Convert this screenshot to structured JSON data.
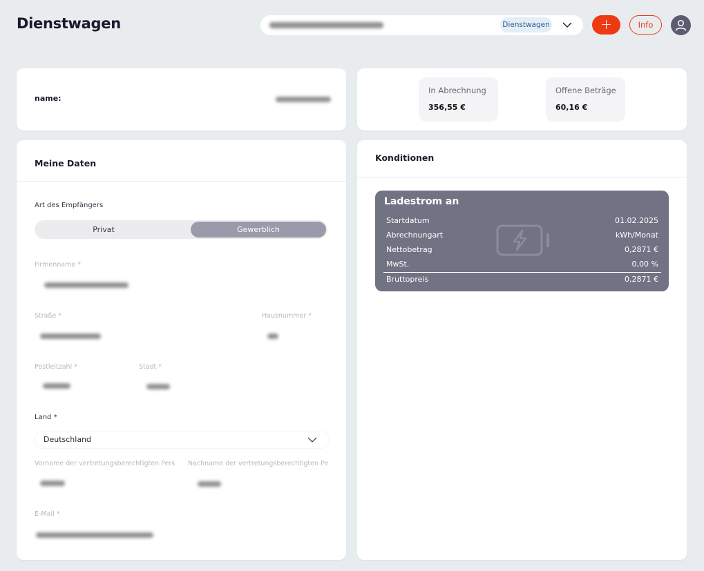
{
  "header": {
    "title": "Dienstwagen",
    "selector_badge": "Dienstwagen",
    "add_label": "+",
    "info_label": "Info"
  },
  "name_card": {
    "label": "name:"
  },
  "stats": [
    {
      "label": "In Abrechnung",
      "value": "356,55 €"
    },
    {
      "label": "Offene Beträge",
      "value": "60,16 €"
    }
  ],
  "meine_daten": {
    "title": "Meine Daten",
    "recipient_type_label": "Art des Empfängers",
    "toggle": {
      "option_1": "Privat",
      "option_2": "Gewerblich",
      "selected": "Gewerblich"
    },
    "fields": {
      "firmenname": "Firmenname *",
      "strasse": "Straße *",
      "hausnummer": "Hausnummer *",
      "plz": "Postleitzahl *",
      "stadt": "Stadt *",
      "land": "Land *",
      "vorname": "Vorname der vertretungsberechtigten Pers",
      "nachname": "Nachname der vertretungsberechtigten Pe",
      "email": "E-Mail *"
    },
    "land_value": "Deutschland"
  },
  "konditionen": {
    "title": "Konditionen",
    "tariff_title": "Ladestrom an",
    "rows": [
      {
        "key": "Startdatum",
        "value": "01.02.2025"
      },
      {
        "key": "Abrechnungart",
        "value": "kWh/Monat"
      },
      {
        "key": "Nettobetrag",
        "value": "0,2871 €"
      },
      {
        "key": "MwSt.",
        "value": "0,00 %"
      },
      {
        "key": "Bruttopreis",
        "value": "0,2871 €"
      }
    ]
  },
  "colors": {
    "accent": "#ee3a12",
    "tariff_bg": "#727285",
    "toggle_selected": "#9a9aab",
    "page_bg": "#e8ecef"
  }
}
